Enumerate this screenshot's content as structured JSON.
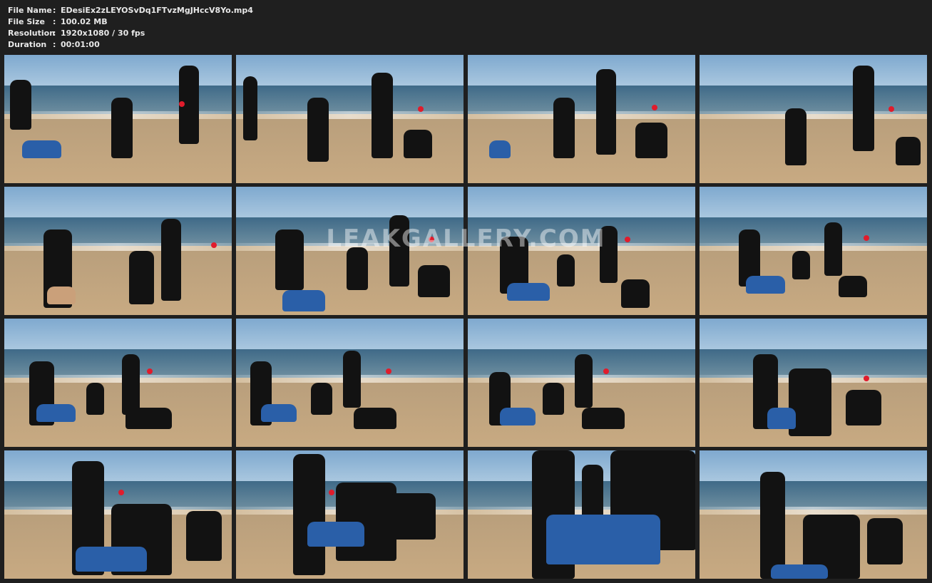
{
  "file_info": [
    {
      "label": "File Name",
      "sep": ":",
      "value": "EDesiEx2zLEYOSvDq1FTvzMgJHccV8Yo.mp4"
    },
    {
      "label": "File Size",
      "sep": ":",
      "value": "100.02 MB"
    },
    {
      "label": "Resolution",
      "sep": ":",
      "value": "1920x1080 / 30 fps"
    },
    {
      "label": "Duration",
      "sep": ":",
      "value": "00:01:00"
    }
  ],
  "watermark": "LEAKGALLERY.COM",
  "thumbnails": [
    {
      "id": 1
    },
    {
      "id": 2
    },
    {
      "id": 3
    },
    {
      "id": 4
    },
    {
      "id": 5
    },
    {
      "id": 6
    },
    {
      "id": 7
    },
    {
      "id": 8
    },
    {
      "id": 9
    },
    {
      "id": 10
    },
    {
      "id": 11
    },
    {
      "id": 12
    },
    {
      "id": 13
    },
    {
      "id": 14
    },
    {
      "id": 15
    },
    {
      "id": 16
    }
  ],
  "colors": {
    "background": "#1f1f1f",
    "text": "#e8e8e8",
    "buoy": "#e01c2c"
  }
}
